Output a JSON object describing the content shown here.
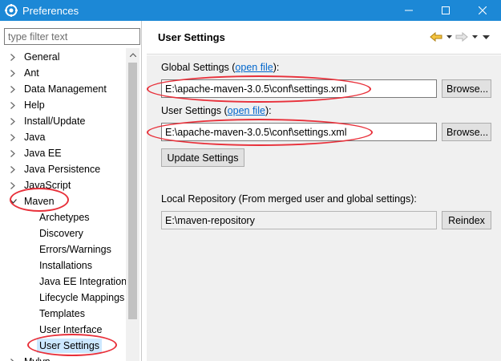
{
  "window": {
    "title": "Preferences"
  },
  "filter": {
    "placeholder": "type filter text"
  },
  "tree": {
    "items": [
      {
        "label": "General",
        "level": 0,
        "expanded": false
      },
      {
        "label": "Ant",
        "level": 0,
        "expanded": false
      },
      {
        "label": "Data Management",
        "level": 0,
        "expanded": false
      },
      {
        "label": "Help",
        "level": 0,
        "expanded": false
      },
      {
        "label": "Install/Update",
        "level": 0,
        "expanded": false
      },
      {
        "label": "Java",
        "level": 0,
        "expanded": false
      },
      {
        "label": "Java EE",
        "level": 0,
        "expanded": false
      },
      {
        "label": "Java Persistence",
        "level": 0,
        "expanded": false
      },
      {
        "label": "JavaScript",
        "level": 0,
        "expanded": false
      },
      {
        "label": "Maven",
        "level": 0,
        "expanded": true
      },
      {
        "label": "Archetypes",
        "level": 1
      },
      {
        "label": "Discovery",
        "level": 1
      },
      {
        "label": "Errors/Warnings",
        "level": 1
      },
      {
        "label": "Installations",
        "level": 1
      },
      {
        "label": "Java EE Integration",
        "level": 1
      },
      {
        "label": "Lifecycle Mappings",
        "level": 1
      },
      {
        "label": "Templates",
        "level": 1
      },
      {
        "label": "User Interface",
        "level": 1
      },
      {
        "label": "User Settings",
        "level": 1,
        "selected": true
      },
      {
        "label": "Mylyn",
        "level": 0,
        "expanded": false
      }
    ]
  },
  "page": {
    "title": "User Settings",
    "global_label": "Global Settings (",
    "global_link": "open file",
    "global_label_end": "):",
    "global_value": "E:\\apache-maven-3.0.5\\conf\\settings.xml",
    "user_label": "User Settings (",
    "user_link": "open file",
    "user_label_end": "):",
    "user_value": "E:\\apache-maven-3.0.5\\conf\\settings.xml",
    "browse_label": "Browse...",
    "update_label": "Update Settings",
    "local_repo_label": "Local Repository (From merged user and global settings):",
    "local_repo_value": "E:\\maven-repository",
    "reindex_label": "Reindex"
  },
  "colors": {
    "titlebar": "#1c88d6",
    "highlight": "#e8303a",
    "selection": "#cce8ff",
    "link": "#0066cc"
  },
  "icons": [
    "preferences-app-icon",
    "minimize-icon",
    "maximize-icon",
    "close-icon",
    "back-icon",
    "forward-icon",
    "menu-icon"
  ]
}
